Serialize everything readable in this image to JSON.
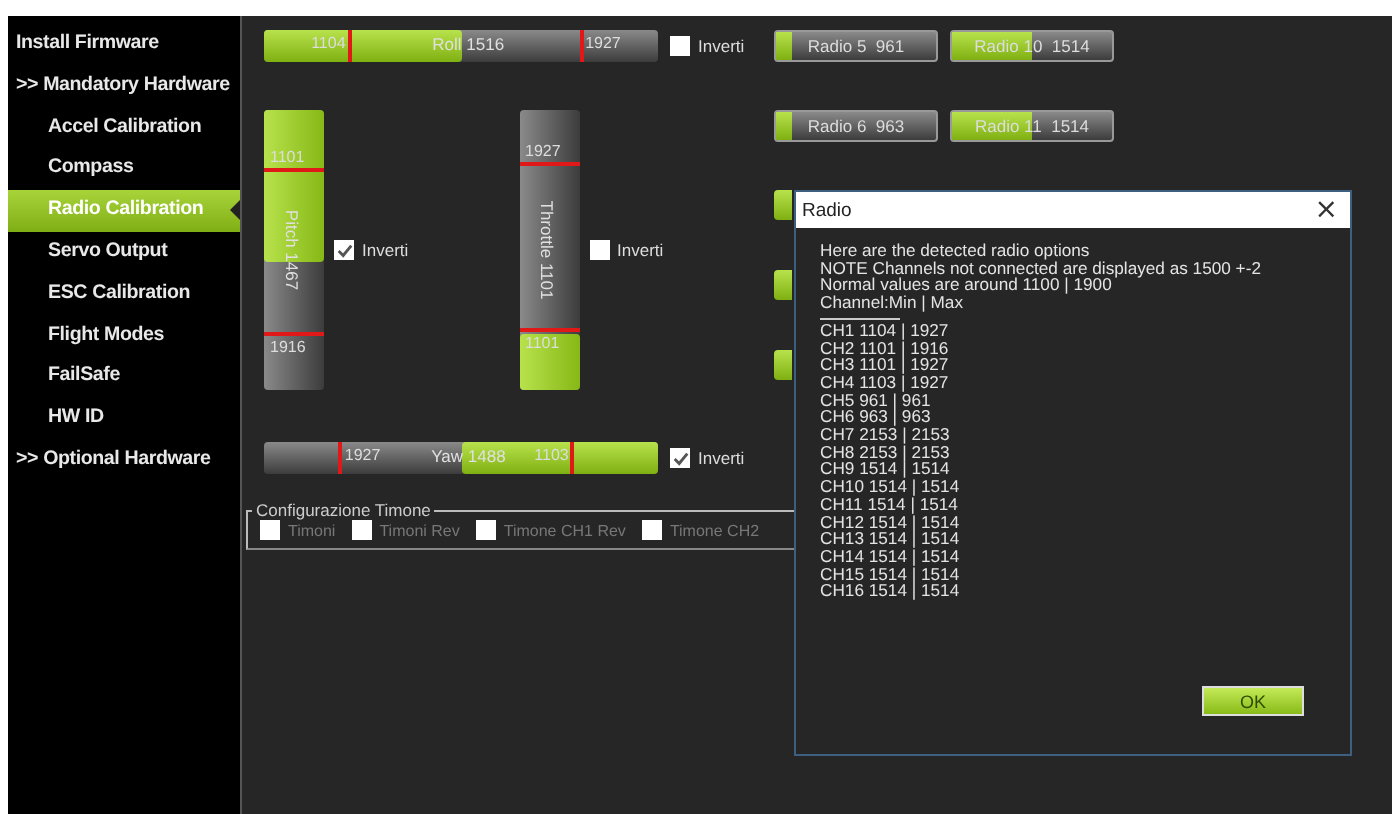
{
  "sidebar": {
    "items": [
      {
        "label": "Install Firmware",
        "kind": "header",
        "selected": false
      },
      {
        "label": ">> Mandatory Hardware",
        "kind": "header",
        "selected": false
      },
      {
        "label": "Accel Calibration",
        "kind": "page",
        "selected": false
      },
      {
        "label": "Compass",
        "kind": "page",
        "selected": false
      },
      {
        "label": "Radio Calibration",
        "kind": "page",
        "selected": true
      },
      {
        "label": "Servo Output",
        "kind": "page",
        "selected": false
      },
      {
        "label": "ESC Calibration",
        "kind": "page",
        "selected": false
      },
      {
        "label": "Flight Modes",
        "kind": "page",
        "selected": false
      },
      {
        "label": "FailSafe",
        "kind": "page",
        "selected": false
      },
      {
        "label": "HW ID",
        "kind": "page",
        "selected": false
      },
      {
        "label": ">> Optional Hardware",
        "kind": "header",
        "selected": false
      }
    ]
  },
  "bars": [
    {
      "kind": "horizontal",
      "label": "Roll 1516",
      "level": 0.5,
      "markers": [
        "1104",
        "1927"
      ],
      "inverted": false,
      "invert_label": "Inverti"
    },
    {
      "kind": "vertical",
      "label": "Pitch 1467",
      "level": 0.54,
      "markers": [
        "1101",
        "1916"
      ],
      "inverted": true,
      "invert_label": "Inverti"
    },
    {
      "kind": "vertical",
      "label": "Throttle 1101",
      "level": 0.2,
      "markers": [
        "1927",
        "1101"
      ],
      "inverted": false,
      "invert_label": "Inverti"
    },
    {
      "kind": "horizontal",
      "label": "Yaw 1488",
      "level": 0.5,
      "markers": [
        "1927",
        "1103"
      ],
      "inverted": true,
      "invert_label": "Inverti"
    }
  ],
  "radios": [
    [
      {
        "kind": "bar",
        "label": "Radio 5  961",
        "level": 0.1
      },
      {
        "kind": "bar",
        "label": "Radio 10  1514",
        "level": 0.5
      }
    ],
    [
      {
        "kind": "bar",
        "label": "Radio 6  963",
        "level": 0.1
      },
      {
        "kind": "bar",
        "label": "Radio 11  1514",
        "level": 0.5
      }
    ],
    [
      {
        "kind": "edge"
      }
    ],
    [
      {
        "kind": "edge"
      }
    ],
    [
      {
        "kind": "edge"
      }
    ]
  ],
  "group": {
    "title": "Configurazione Timone",
    "options": [
      {
        "label": "Timoni",
        "checked": false,
        "disabled": true
      },
      {
        "label": "Timoni Rev",
        "checked": false,
        "disabled": true
      },
      {
        "label": "Timone CH1 Rev",
        "checked": false,
        "disabled": true
      },
      {
        "label": "Timone CH2",
        "checked": false,
        "disabled": true
      }
    ]
  },
  "dialog": {
    "title": "Radio",
    "close": "×",
    "intro": [
      "Here are the detected radio options",
      "NOTE Channels not connected are displayed as 1500 +-2",
      "Normal values are around 1100 | 1900",
      "Channel:Min | Max"
    ],
    "channels": [
      "CH1 1104 | 1927",
      "CH2 1101 | 1916",
      "CH3 1101 | 1927",
      "CH4 1103 | 1927",
      "CH5 961 | 961",
      "CH6 963 | 963",
      "CH7 2153 | 2153",
      "CH8 2153 | 2153",
      "CH9 1514 | 1514",
      "CH10 1514 | 1514",
      "CH11 1514 | 1514",
      "CH12 1514 | 1514",
      "CH13 1514 | 1514",
      "CH14 1514 | 1514",
      "CH15 1514 | 1514",
      "CH16 1514 | 1514"
    ],
    "button": "OK"
  }
}
